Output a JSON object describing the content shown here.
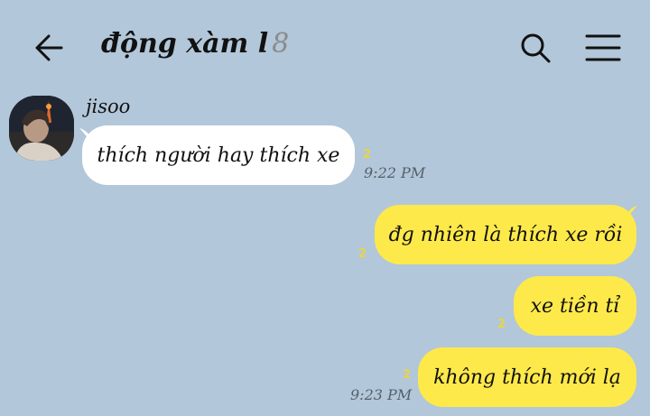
{
  "header": {
    "title": "động xàm l",
    "member_count": "8",
    "back_icon": "back-arrow-icon",
    "search_icon": "search-icon",
    "menu_icon": "hamburger-menu-icon"
  },
  "colors": {
    "background": "#b2c7d9",
    "incoming_bubble": "#ffffff",
    "outgoing_bubble": "#fee94a",
    "unread_marker": "#e9d445"
  },
  "messages": [
    {
      "sender": "jisoo",
      "text": "thích người hay thích xe",
      "unread": "2",
      "time": "9:22 PM",
      "direction": "incoming"
    },
    {
      "text": "đg nhiên là thích xe rồi",
      "unread": "2",
      "time": "",
      "direction": "outgoing"
    },
    {
      "text": "xe tiền tỉ",
      "unread": "2",
      "time": "",
      "direction": "outgoing"
    },
    {
      "text": "không thích mới lạ",
      "unread": "2",
      "time": "9:23 PM",
      "direction": "outgoing"
    }
  ]
}
